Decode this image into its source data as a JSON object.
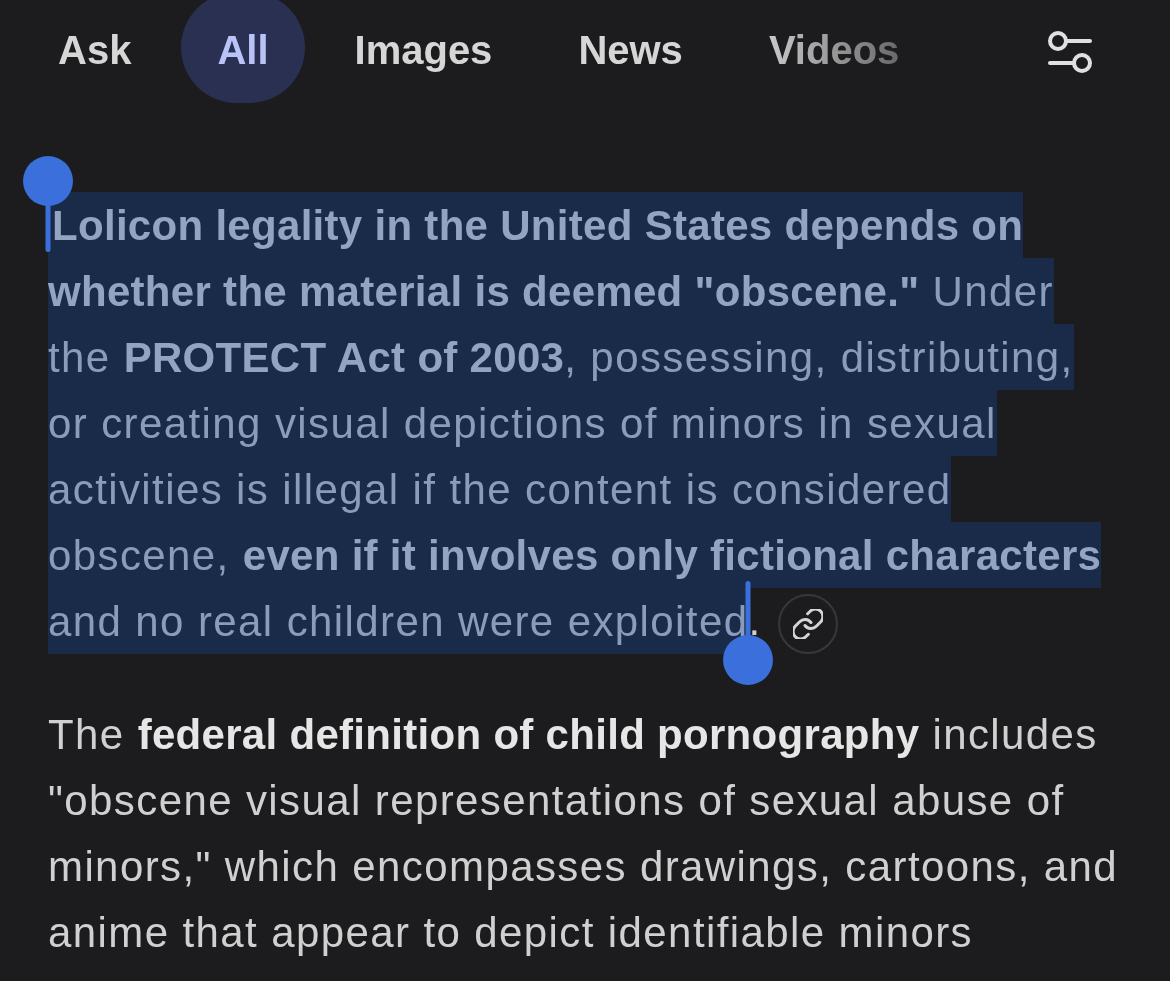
{
  "tabs": [
    {
      "label": "Ask",
      "selected": false
    },
    {
      "label": "All",
      "selected": true
    },
    {
      "label": "Images",
      "selected": false
    },
    {
      "label": "News",
      "selected": false
    },
    {
      "label": "Videos",
      "selected": false
    }
  ],
  "answer": {
    "paragraphs": [
      {
        "segments": [
          {
            "text": "**Lolicon legality in the United States depends on whether the material is deemed \"obscene.\"** Under the **PROTECT Act of 2003**, possessing, distributing, or creating visual depictions of minors in sexual activities is illegal if the content is considered obscene, **even if it involves only fictional characters** and no real children were exploited",
            "selected": true
          },
          {
            "text": ".",
            "selected": false
          }
        ],
        "link_button": true
      },
      {
        "segments": [
          {
            "text": "The **federal definition of child pornography** includes \"obscene visual representations of sexual abuse of minors,\" which encompasses drawings, cartoons, and anime that appear to depict identifiable minors",
            "selected": false
          }
        ]
      }
    ]
  }
}
